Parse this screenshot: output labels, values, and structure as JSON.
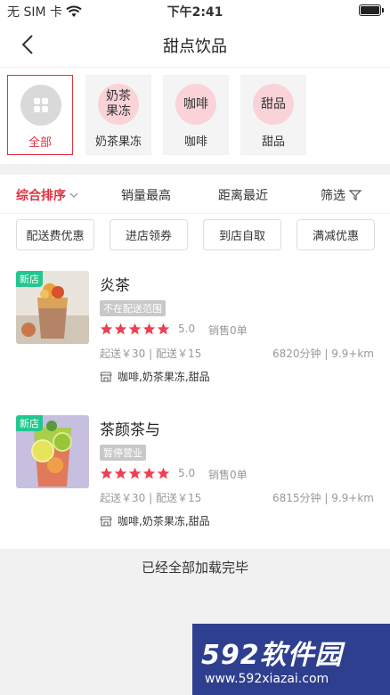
{
  "status_bar": {
    "carrier": "无 SIM 卡",
    "time": "下午2:41"
  },
  "nav": {
    "title": "甜点饮品"
  },
  "categories": [
    {
      "circle_text": "",
      "label": "全部"
    },
    {
      "circle_text": "奶茶果冻",
      "label": "奶茶果冻"
    },
    {
      "circle_text": "咖啡",
      "label": "咖啡"
    },
    {
      "circle_text": "甜品",
      "label": "甜品"
    }
  ],
  "sort": {
    "items": [
      "综合排序",
      "销量最高",
      "距离最近",
      "筛选"
    ]
  },
  "chips": [
    "配送费优惠",
    "进店领券",
    "到店自取",
    "满减优惠"
  ],
  "shops": [
    {
      "name": "炎茶",
      "badge": "新店",
      "status": "不在配送范围",
      "rating": "5.0",
      "sales": "销售0单",
      "fees": "起送￥30 | 配送￥15",
      "distance": "6820分钟 | 9.9+km",
      "tags": "咖啡,奶茶果冻,甜品"
    },
    {
      "name": "茶颜茶与",
      "badge": "新店",
      "status": "暂停营业",
      "rating": "5.0",
      "sales": "销售0单",
      "fees": "起送￥30 | 配送￥15",
      "distance": "6815分钟 | 9.9+km",
      "tags": "咖啡,奶茶果冻,甜品"
    }
  ],
  "footer": {
    "end_text": "已经全部加载完毕"
  },
  "watermark": {
    "brand": "592软件园",
    "url": "www.592xiazai.com"
  },
  "colors": {
    "accent": "#e0303f",
    "star": "#f03e52",
    "new_badge": "#22c78f"
  }
}
